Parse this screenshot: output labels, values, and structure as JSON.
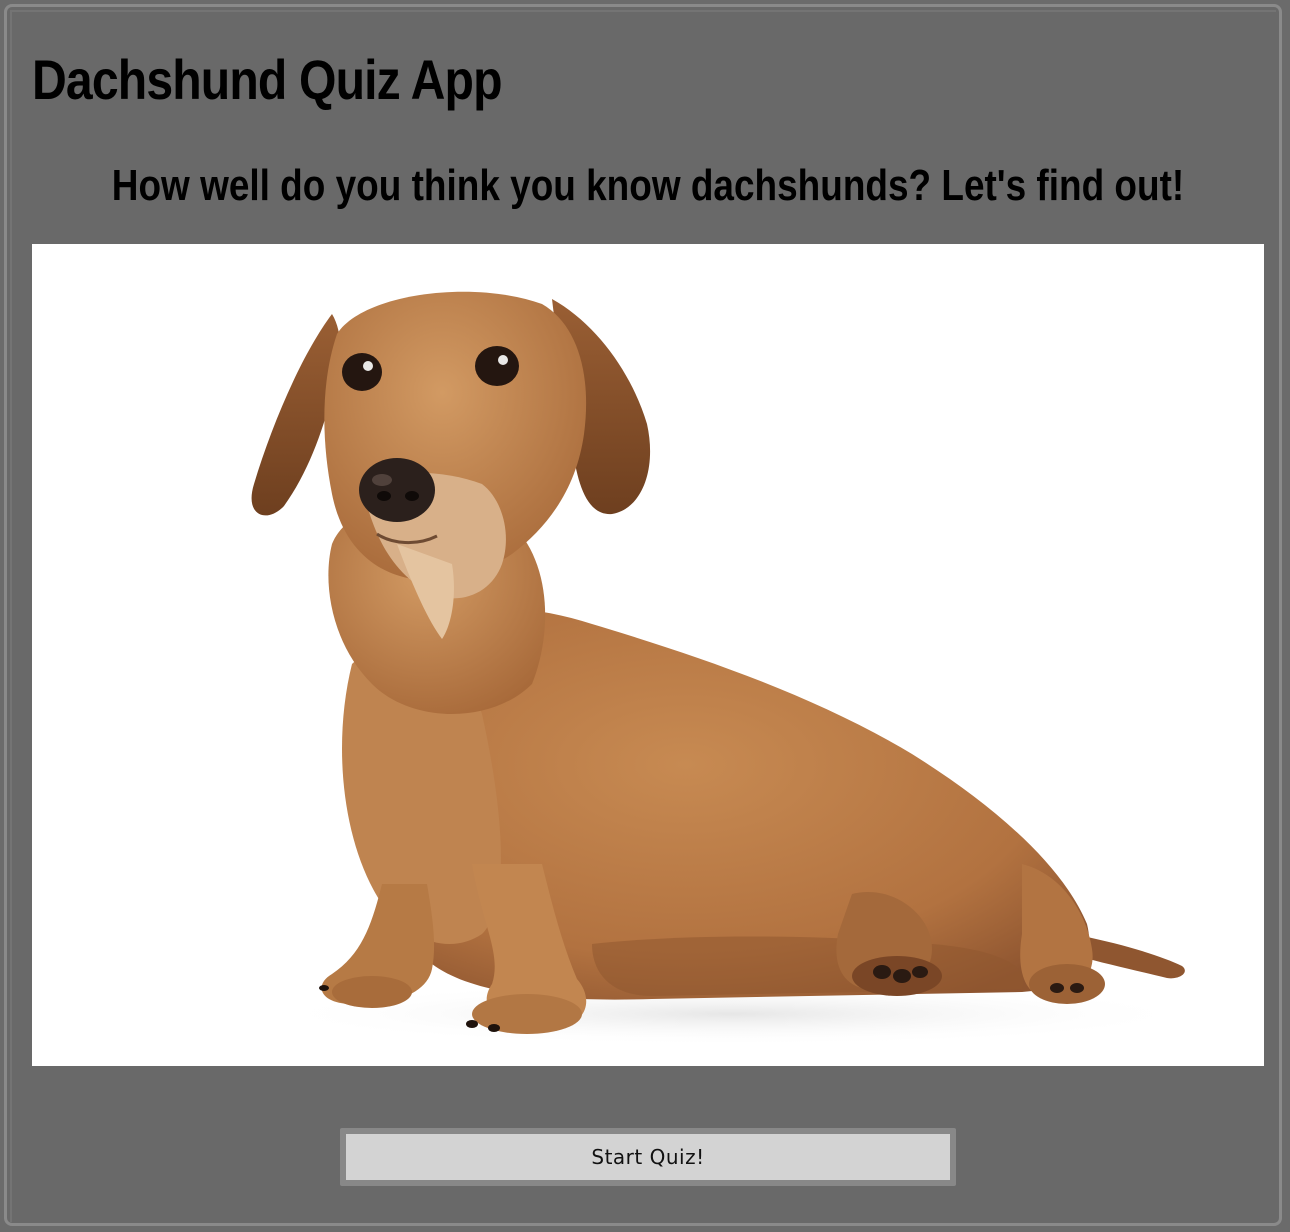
{
  "app": {
    "title": "Dachshund Quiz App",
    "subtitle": "How well do you think you know dachshunds? Let's find out!"
  },
  "hero_image": {
    "subject": "wire-haired dachshund sitting on white background",
    "background_color": "#ffffff",
    "fur_color": "#b67a43"
  },
  "start_button": {
    "label": "Start Quiz!"
  },
  "colors": {
    "page_background": "#696969",
    "frame_border": "#8a8a8a",
    "button_face": "#d3d3d3",
    "button_border": "#888888",
    "text": "#000000"
  }
}
